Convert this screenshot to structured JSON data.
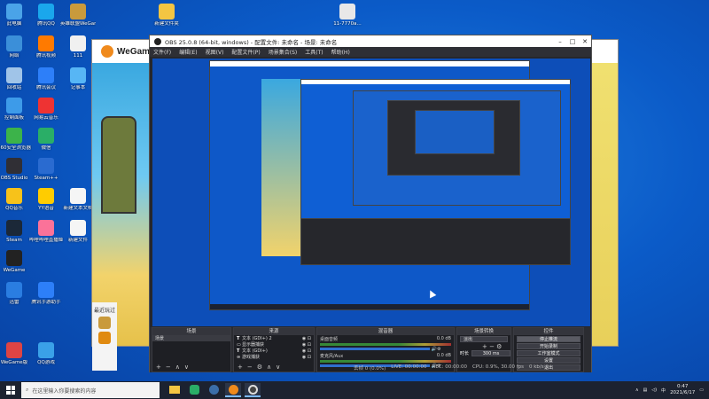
{
  "desktop": {
    "icons": [
      {
        "label": "此电脑",
        "color": "#4aa3e8"
      },
      {
        "label": "腾讯QQ",
        "color": "#1aa7ec"
      },
      {
        "label": "英雄联盟WeGame版",
        "color": "#c99a3c"
      },
      {
        "label": "新建文件夹",
        "color": "#f4c542"
      },
      {
        "label": "11-7770a...",
        "color": "#e8e8e8"
      },
      {
        "label": "网络",
        "color": "#3b8fd9"
      },
      {
        "label": "腾讯视频",
        "color": "#ff7a00"
      },
      {
        "label": "111",
        "color": "#f0f0f0"
      },
      {
        "label": "回收站",
        "color": "#a0c4e8"
      },
      {
        "label": "腾讯会议",
        "color": "#2d7ff9"
      },
      {
        "label": "记事本",
        "color": "#57b6f5"
      },
      {
        "label": "控制面板",
        "color": "#3d9be9"
      },
      {
        "label": "网易云音乐",
        "color": "#e33"
      },
      {
        "label": "360安全浏览器",
        "color": "#3cb34a"
      },
      {
        "label": "微信",
        "color": "#2aae67"
      },
      {
        "label": "OBS Studio",
        "color": "#302f35"
      },
      {
        "label": "Steam++",
        "color": "#2a6bd0"
      },
      {
        "label": "QQ音乐",
        "color": "#f7c21a"
      },
      {
        "label": "YY语音",
        "color": "#ffcc00"
      },
      {
        "label": "新建文本文档",
        "color": "#f5f5f5"
      },
      {
        "label": "Steam",
        "color": "#1b2838"
      },
      {
        "label": "哔哩哔哩直播姬",
        "color": "#fb7299"
      },
      {
        "label": "新建文件",
        "color": "#f5f5f5"
      },
      {
        "label": "WeGame",
        "color": "#222"
      },
      {
        "label": "迅雷",
        "color": "#2a7de1"
      },
      {
        "label": "腾讯手游助手",
        "color": "#2d7ff9"
      },
      {
        "label": "WeGame版",
        "color": "#d44"
      },
      {
        "label": "QQ游戏",
        "color": "#3aa1e8"
      }
    ]
  },
  "wegame": {
    "title": "WeGame",
    "favorites_label": "最近玩过"
  },
  "obs": {
    "window_title": "OBS 25.0.8 (64-bit, windows) - 配置文件: 未命名 - 场景: 未命名",
    "menu": [
      "文件(F)",
      "编辑(E)",
      "视图(V)",
      "配置文件(P)",
      "场景集合(S)",
      "工具(T)",
      "帮助(H)"
    ],
    "docks": {
      "scenes": {
        "title": "场景",
        "items": [
          "场景"
        ]
      },
      "sources": {
        "title": "来源",
        "items": [
          {
            "type": "T",
            "label": "文本 (GDI+) 2"
          },
          {
            "type": "▭",
            "label": "显示器捕获"
          },
          {
            "type": "T",
            "label": "文本 (GDI+)"
          },
          {
            "type": "∞",
            "label": "游戏捕获"
          }
        ]
      },
      "mixer": {
        "title": "混音器",
        "channels": [
          {
            "name": "桌面音频",
            "db": "0.0 dB"
          },
          {
            "name": "麦克风/Aux",
            "db": "0.0 dB"
          }
        ]
      },
      "transitions": {
        "title": "场景转换",
        "type": "淡出",
        "duration_label": "时长",
        "duration": "300 ms"
      },
      "controls": {
        "title": "控件",
        "buttons": [
          "停止推流",
          "开始录制",
          "工作室模式",
          "设置",
          "退出"
        ]
      }
    },
    "status": {
      "dropped": "丢帧 0 (0.0%)",
      "live": "LIVE: 00:00:00",
      "rec": "REC: 00:00:00",
      "cpu": "CPU: 0.9%, 30.00 fps",
      "kbps": "0 kb/s"
    }
  },
  "taskbar": {
    "search_placeholder": "在这里输入你要搜索的内容",
    "time": "0:47",
    "date": "2021/6/17"
  }
}
